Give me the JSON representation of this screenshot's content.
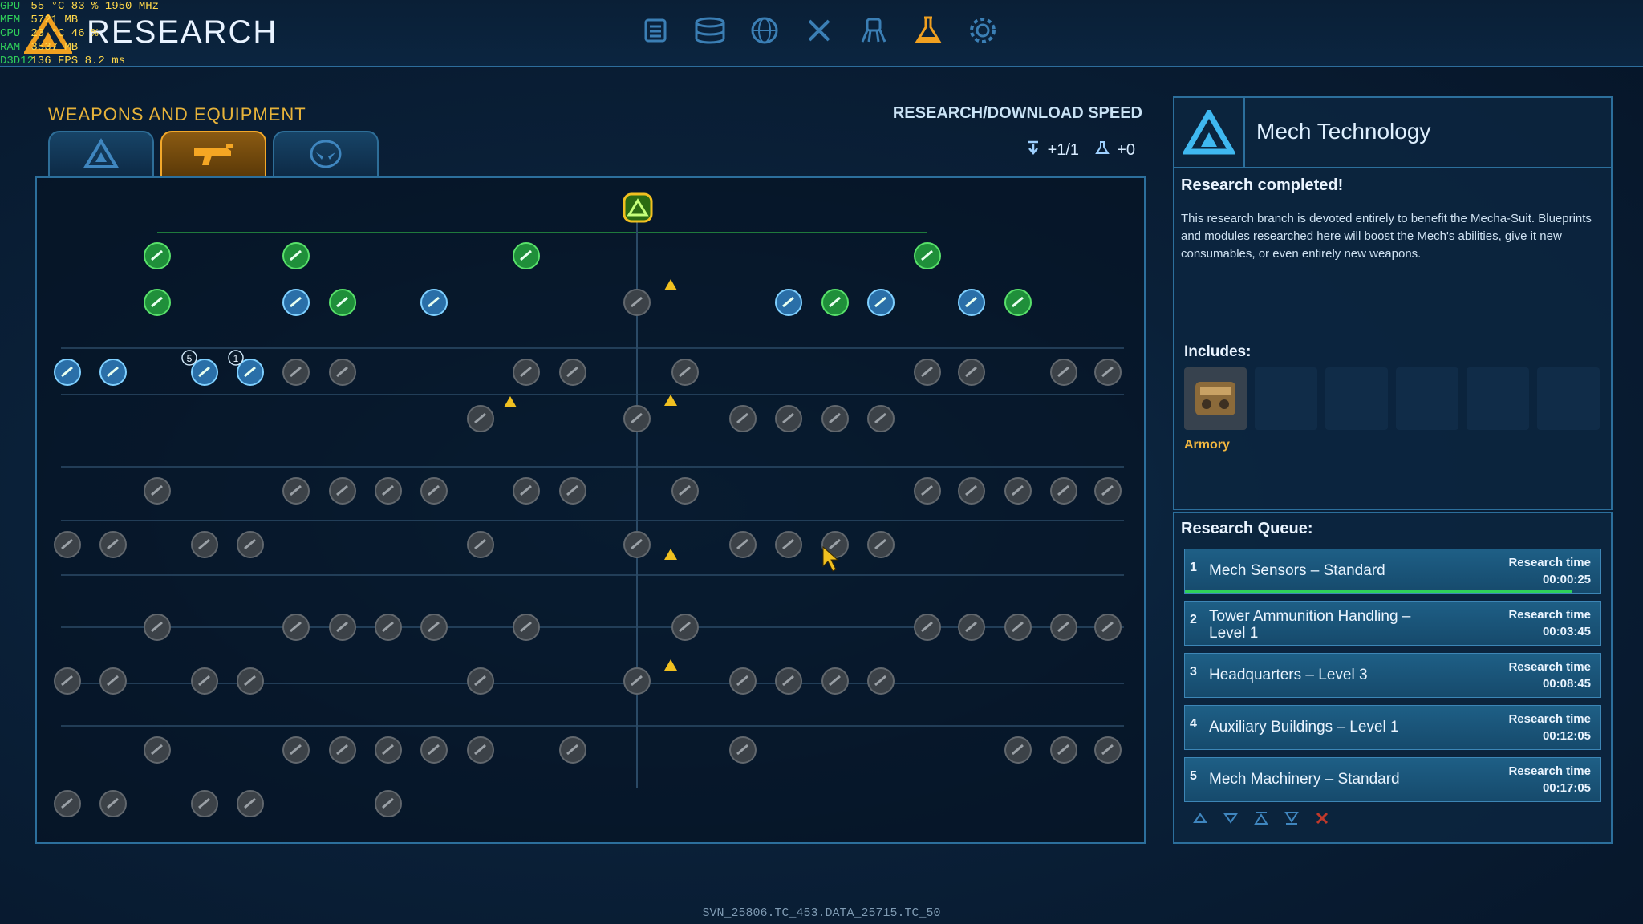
{
  "hud": {
    "rows": [
      {
        "key": "GPU",
        "val": "55 °C   83 %   1950 MHz"
      },
      {
        "key": "MEM",
        "val": "5721 MB"
      },
      {
        "key": "CPU",
        "val": "23 °C  46 %"
      },
      {
        "key": "RAM",
        "val": "3537 MB"
      },
      {
        "key": "D3D12",
        "val": "136 FPS   8.2 ms"
      }
    ]
  },
  "header": {
    "title": "RESEARCH"
  },
  "nav": {
    "icons": [
      "list-icon",
      "database-icon",
      "globe-icon",
      "tools-icon",
      "mech-icon",
      "flask-icon",
      "gear-icon"
    ],
    "active": "flask-icon"
  },
  "section": {
    "title": "WEAPONS AND EQUIPMENT"
  },
  "tabs": [
    "mech-tab-icon",
    "weapon-tab-icon",
    "alien-tab-icon"
  ],
  "speed": {
    "title": "RESEARCH/DOWNLOAD SPEED",
    "download": "+1/1",
    "research": "+0"
  },
  "detail": {
    "name": "Mech Technology",
    "status": "Research completed!",
    "description": "This research branch is devoted entirely to benefit the Mecha-Suit. Blueprints and modules researched here will boost the Mech's abilities, give it new consumables, or even entirely new weapons.",
    "includes_label": "Includes:",
    "includes": [
      {
        "name": "Armory"
      }
    ]
  },
  "queue": {
    "title": "Research Queue:",
    "time_label": "Research time",
    "items": [
      {
        "num": "1",
        "name": "Mech Sensors – Standard",
        "time": "00:00:25",
        "progress": 0.93
      },
      {
        "num": "2",
        "name": "Tower Ammunition Handling – Level 1",
        "time": "00:03:45"
      },
      {
        "num": "3",
        "name": "Headquarters – Level 3",
        "time": "00:08:45"
      },
      {
        "num": "4",
        "name": "Auxiliary Buildings – Level 1",
        "time": "00:12:05"
      },
      {
        "num": "5",
        "name": "Mech Machinery – Standard",
        "time": "00:17:05"
      }
    ],
    "controls": [
      "move-up-icon",
      "move-down-icon",
      "move-top-icon",
      "move-bottom-icon",
      "remove-icon"
    ]
  },
  "tree": {
    "badges": [
      "5",
      "1"
    ],
    "nodes": [
      {
        "id": "root",
        "state": "gold"
      },
      {
        "id": "a1",
        "state": "done"
      },
      {
        "id": "a2",
        "state": "done"
      },
      {
        "id": "a3",
        "state": "done"
      },
      {
        "id": "a4",
        "state": "done"
      },
      {
        "id": "b1",
        "state": "done"
      },
      {
        "id": "b2",
        "state": "available"
      },
      {
        "id": "b3",
        "state": "done"
      },
      {
        "id": "b4",
        "state": "available"
      },
      {
        "id": "b5",
        "state": "locked"
      },
      {
        "id": "b6",
        "state": "available"
      },
      {
        "id": "b7",
        "state": "done"
      },
      {
        "id": "b8",
        "state": "available"
      },
      {
        "id": "b9",
        "state": "available"
      },
      {
        "id": "b10",
        "state": "done"
      }
    ]
  },
  "footer": "SVN_25806.TC_453.DATA_25715.TC_50"
}
